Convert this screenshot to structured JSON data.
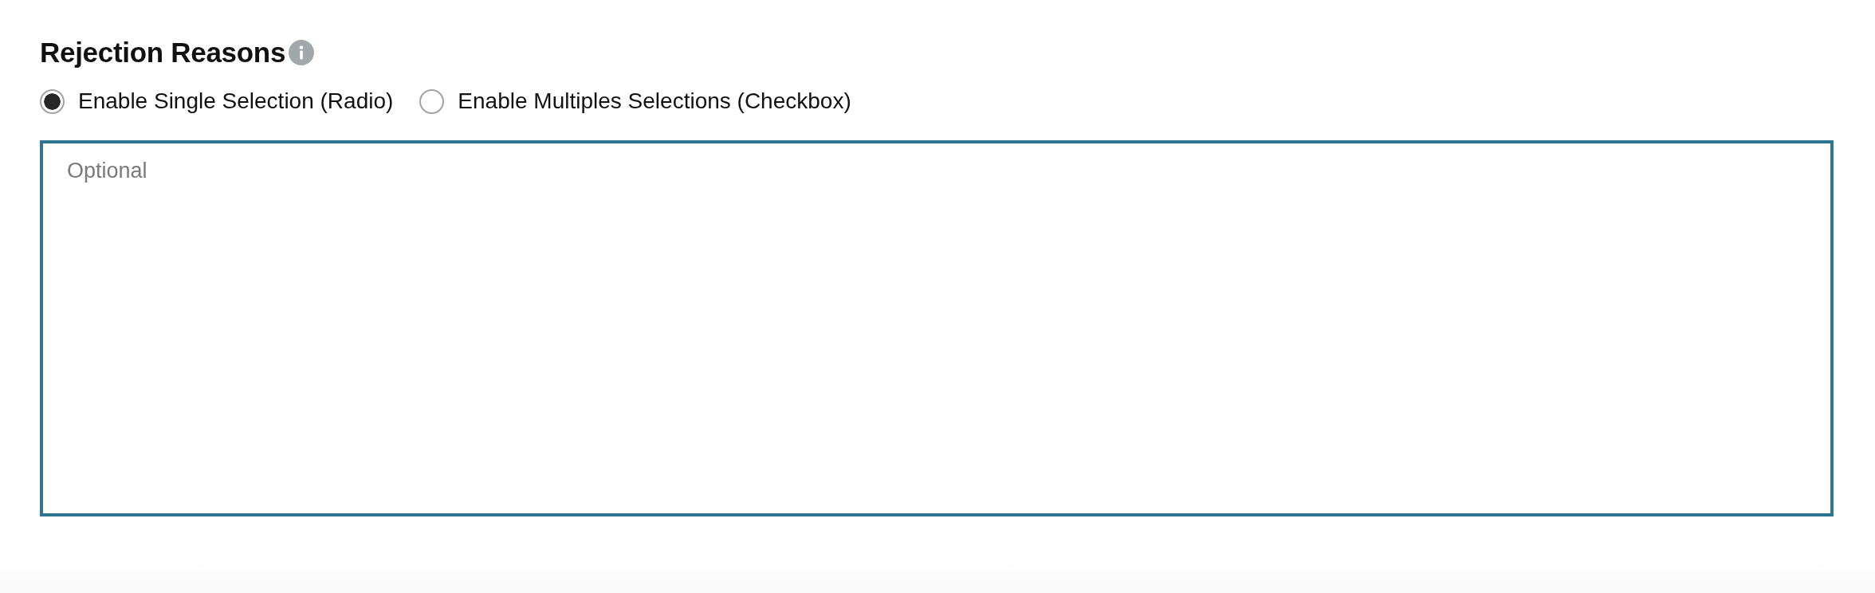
{
  "section": {
    "title": "Rejection Reasons"
  },
  "selection_modes": [
    {
      "label": "Enable Single Selection (Radio)",
      "selected": true
    },
    {
      "label": "Enable Multiples Selections (Checkbox)",
      "selected": false
    }
  ],
  "reasons_field": {
    "placeholder": "Optional"
  }
}
